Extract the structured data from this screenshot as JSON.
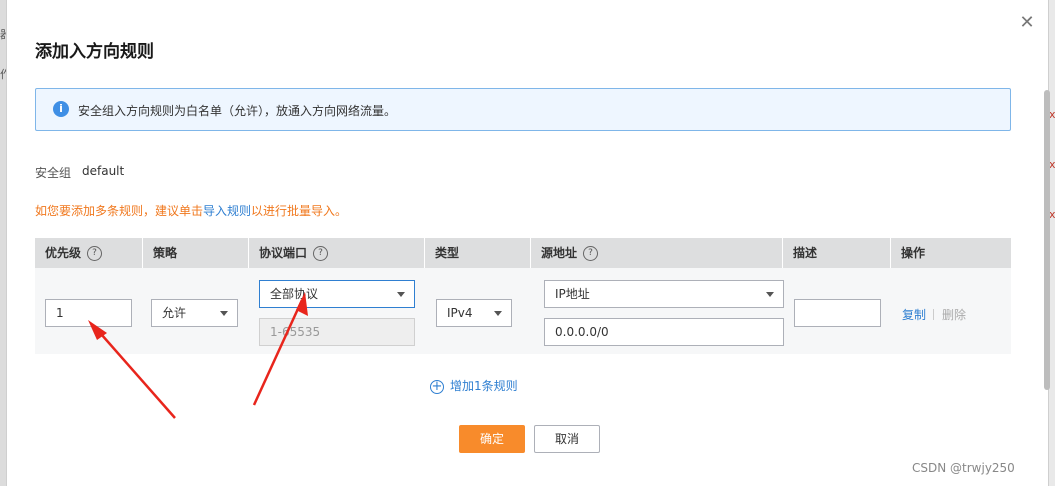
{
  "background": {
    "left_chars": [
      "器",
      "作"
    ],
    "right_chars": [
      "x",
      "x",
      "x"
    ]
  },
  "dialog": {
    "title": "添加入方向规则",
    "close_icon": "close-icon",
    "info_text": "安全组入方向规则为白名单（允许），放通入方向网络流量。",
    "security_group_label": "安全组",
    "security_group_value": "default",
    "hint": {
      "prefix": "如您要添加多条规则，建议单击",
      "link": "导入规则",
      "suffix": "以进行批量导入。"
    },
    "table": {
      "headers": {
        "priority": "优先级",
        "policy": "策略",
        "protocol_port": "协议端口",
        "type": "类型",
        "source": "源地址",
        "description": "描述",
        "operation": "操作"
      },
      "row": {
        "priority_value": "1",
        "policy_selected": "允许",
        "protocol_selected": "全部协议",
        "port_value": "1-65535",
        "type_selected": "IPv4",
        "source_type_selected": "IP地址",
        "source_value": "0.0.0.0/0",
        "description_value": "",
        "copy_label": "复制",
        "delete_label": "删除"
      }
    },
    "add_rule_label": "增加1条规则",
    "ok_label": "确定",
    "cancel_label": "取消"
  },
  "colors": {
    "primary": "#f88b2b",
    "link": "#2f7fd1",
    "hint": "#f0781e",
    "annotation_arrow": "#e8251c"
  },
  "watermark": "CSDN @trwjy250"
}
